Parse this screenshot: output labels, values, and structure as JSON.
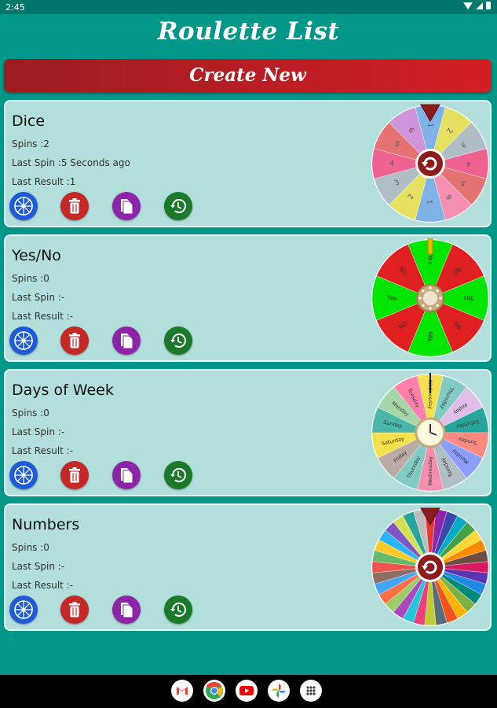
{
  "status_bar": {
    "time": "2:45"
  },
  "app": {
    "title": "Roulette List",
    "create_label": "Create New"
  },
  "cards": [
    {
      "name": "Dice",
      "spins": "Spins :2",
      "last_spin": "Last Spin :5 Seconds ago",
      "last_result": "Last Result :1",
      "wheel_labels": [
        "1",
        "2",
        "3",
        "4",
        "5",
        "6",
        "1",
        "2",
        "3",
        "4",
        "5",
        "6"
      ]
    },
    {
      "name": "Yes/No",
      "spins": "Spins :0",
      "last_spin": "Last Spin :-",
      "last_result": "Last Result :-",
      "wheel_labels": [
        "Yes",
        "No",
        "Yes",
        "No",
        "Yes",
        "No",
        "Yes",
        "No"
      ]
    },
    {
      "name": "Days of Week",
      "spins": "Spins :0",
      "last_spin": "Last Spin :-",
      "last_result": "Last Result :-",
      "wheel_labels": [
        "Wednesday",
        "Thursday",
        "Friday",
        "Saturday",
        "Sunday",
        "Monday",
        "Tuesday",
        "Wednesday",
        "Thursday",
        "Friday",
        "Saturday",
        "Sunday",
        "Monday",
        "Tuesday"
      ]
    },
    {
      "name": "Numbers",
      "spins": "Spins :0",
      "last_spin": "Last Spin :-",
      "last_result": "Last Result :-"
    }
  ],
  "icons": {
    "spin": "wheel-icon",
    "delete": "trash-icon",
    "copy": "copy-file-icon",
    "history": "history-icon",
    "dock": [
      "gmail-icon",
      "chrome-icon",
      "youtube-icon",
      "photos-icon",
      "app-drawer-icon"
    ]
  },
  "colors": {
    "background": "#009688",
    "create_button": "#c62828",
    "card": "#b2dfdb",
    "spin_button": "#1e5bd9",
    "delete_button": "#c62828",
    "copy_button": "#8e24aa",
    "history_button": "#1b7a2a"
  }
}
